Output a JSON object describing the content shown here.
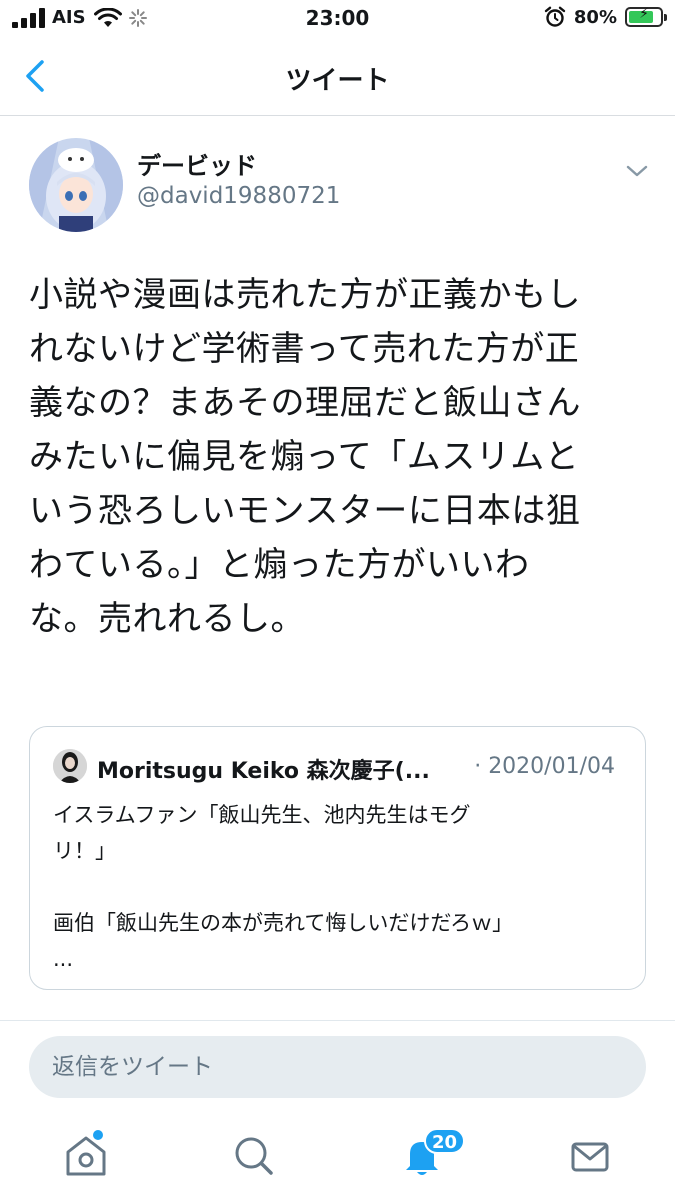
{
  "status_bar": {
    "carrier": "AIS",
    "time": "23:00",
    "battery_percent": "80%",
    "battery_level": 0.8,
    "icons": [
      "signal-icon",
      "wifi-icon",
      "activity-spinner-icon",
      "alarm-icon",
      "battery-charging-icon"
    ]
  },
  "nav": {
    "title": "ツイート",
    "back_icon": "chevron-left-icon"
  },
  "tweet": {
    "display_name": "デービッド",
    "handle": "@david19880721",
    "text_lines": [
      "小説や漫画は売れた方が正義かもし",
      "れないけど学術書って売れた方が正",
      "義なの？まあその理屈だと飯山さん",
      "みたいに偏見を煽って「ムスリムと",
      "いう恐ろしいモンスターに日本は狙",
      "わている。」と煽った方がいいわ",
      "な。売れれるし。"
    ],
    "quoted": {
      "name": "Moritsugu Keiko 森次慶子(...",
      "date": "· 2020/01/04",
      "text_lines": [
        "イスラムファン「飯山先生、池内先生はモグ",
        "リ！」",
        "",
        "画伯「飯山先生の本が売れて悔しいだけだろｗ」",
        "..."
      ]
    }
  },
  "reply": {
    "placeholder": "返信をツイート"
  },
  "tab_bar": {
    "notification_count": "20",
    "accent_color": "#1da1f2",
    "tabs": [
      "home-icon",
      "search-icon",
      "notifications-icon",
      "messages-icon"
    ]
  }
}
